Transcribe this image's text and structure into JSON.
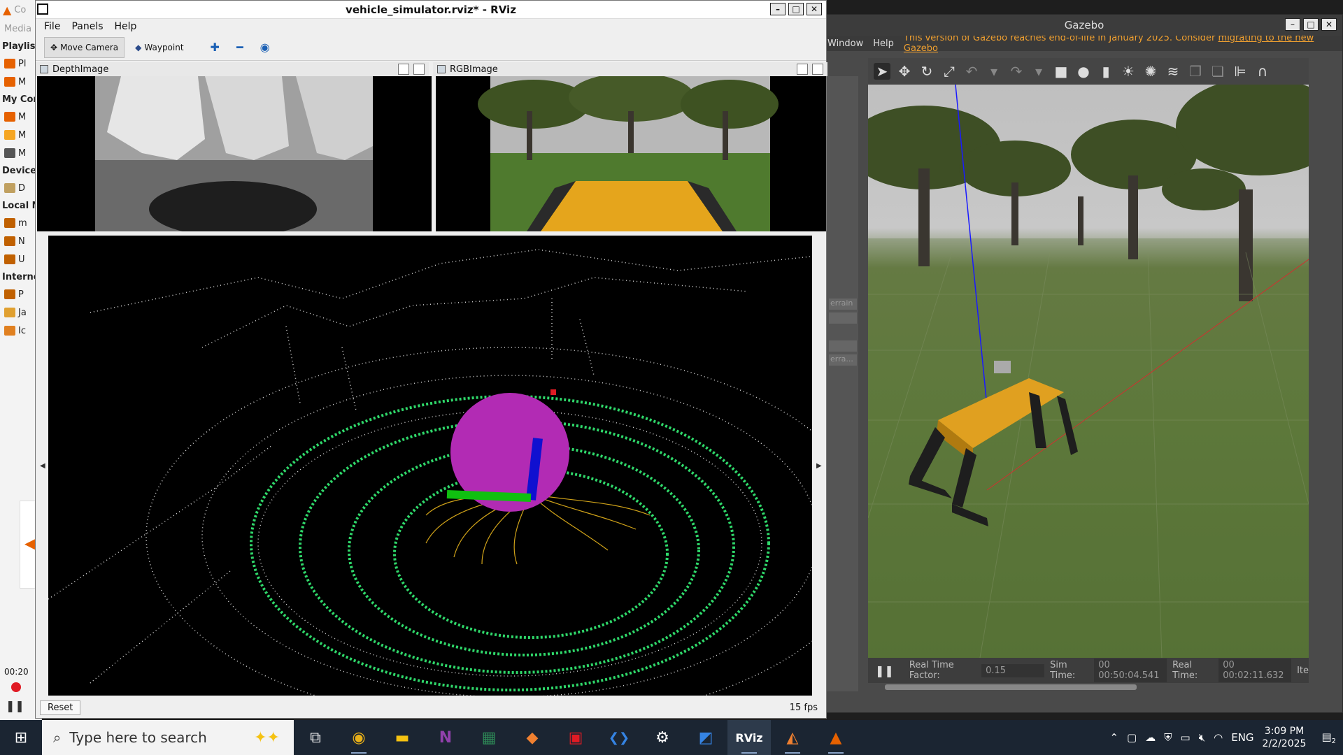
{
  "vlc": {
    "title_fragment": "Co",
    "media_label": "Media",
    "playlist_label": "Playlist",
    "items": [
      {
        "label": "Pl",
        "icon": "playlist-icon",
        "color": "#e66100"
      },
      {
        "label": "M",
        "icon": "media-library-icon",
        "color": "#e66100"
      }
    ],
    "my_computer_label": "My Cor",
    "my_computer_items": [
      {
        "label": "M",
        "icon": "video-folder-icon",
        "color": "#e66100"
      },
      {
        "label": "M",
        "icon": "music-icon",
        "color": "#f5a623"
      },
      {
        "label": "M",
        "icon": "pictures-icon",
        "color": "#555555"
      }
    ],
    "devices_label": "Device",
    "device_items": [
      {
        "label": "D",
        "icon": "disc-icon",
        "color": "#c0a060"
      }
    ],
    "local_label": "Local N",
    "local_items": [
      {
        "label": "m",
        "icon": "network-icon",
        "color": "#c06000"
      },
      {
        "label": "N",
        "icon": "network-icon",
        "color": "#c06000"
      },
      {
        "label": "U",
        "icon": "network-icon",
        "color": "#c06000"
      }
    ],
    "internet_label": "Interne",
    "internet_items": [
      {
        "label": "P",
        "icon": "podcast-icon",
        "color": "#c06000"
      },
      {
        "label": "Ja",
        "icon": "jamendo-icon",
        "color": "#e0a030"
      },
      {
        "label": "Ic",
        "icon": "icecast-icon",
        "color": "#e08020"
      }
    ],
    "time": "00:20"
  },
  "rviz": {
    "title": "vehicle_simulator.rviz* - RViz",
    "menu": [
      "File",
      "Panels",
      "Help"
    ],
    "tools": {
      "move_camera": "Move Camera",
      "waypoint": "Waypoint"
    },
    "depth_panel_title": "DepthImage",
    "rgb_panel_title": "RGBImage",
    "reset_label": "Reset",
    "fps": "15 fps"
  },
  "gazebo": {
    "title": "Gazebo",
    "menu_window": "Window",
    "menu_help": "Help",
    "notice_text": "This version of Gazebo reaches end-of-life in January 2025. Consider ",
    "notice_link": "migrating to the new Gazebo",
    "left_slots": [
      "errain",
      "",
      "",
      "erra..."
    ],
    "status": {
      "rtf_label": "Real Time Factor:",
      "rtf_value": "0.15",
      "sim_label": "Sim Time:",
      "sim_value": "00 00:50:04.541",
      "real_label": "Real Time:",
      "real_value": "00 00:02:11.632",
      "trailing": "Ite"
    }
  },
  "taskbar": {
    "search_placeholder": "Type here to search",
    "apps": [
      {
        "name": "task-view",
        "glyph": "⧉"
      },
      {
        "name": "chrome",
        "glyph": "◉"
      },
      {
        "name": "file-explorer",
        "glyph": "▬"
      },
      {
        "name": "onenote",
        "glyph": "N"
      },
      {
        "name": "spreadsheet",
        "glyph": "▦"
      },
      {
        "name": "git",
        "glyph": "◆"
      },
      {
        "name": "office",
        "glyph": "▣"
      },
      {
        "name": "vscode",
        "glyph": "❮❯"
      },
      {
        "name": "settings",
        "glyph": "⚙"
      },
      {
        "name": "remote-desktop",
        "glyph": "◩"
      },
      {
        "name": "rviz",
        "glyph": "RViz"
      },
      {
        "name": "ros",
        "glyph": "◭"
      },
      {
        "name": "vlc",
        "glyph": "▲"
      }
    ],
    "language": "ENG",
    "time": "3:09 PM",
    "date": "2/2/2025",
    "notifications": "2"
  }
}
